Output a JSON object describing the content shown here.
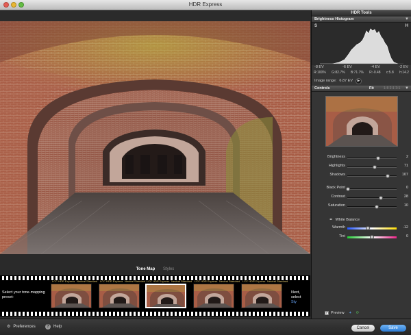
{
  "window": {
    "title": "HDR Express"
  },
  "panel": {
    "title": "HDR Tools",
    "histogram": {
      "header": "Brightness Histogram",
      "shadow_label": "S",
      "highlight_label": "H",
      "ev_labels": [
        "-8 EV",
        "-6 EV",
        "-4 EV",
        "-2 EV"
      ],
      "stats": [
        "R:100%",
        "G:82.7%",
        "B:71.7%",
        "R:-0.48",
        "c:5.8",
        "h:14.2"
      ],
      "range_label": "Image range:",
      "range_value": "6.87 EV"
    },
    "controls": {
      "header": "Controls",
      "fit_label": "Fit",
      "zoom_label": "1:8  2:1  3:1",
      "sliders": [
        {
          "label": "Brightness",
          "value": "2",
          "fraction": 0.62
        },
        {
          "label": "Highlights",
          "value": "71",
          "fraction": 0.55
        },
        {
          "label": "Shadows",
          "value": "107",
          "fraction": 0.82
        }
      ],
      "sliders2": [
        {
          "label": "Black Point",
          "value": "0",
          "fraction": 0.02
        },
        {
          "label": "Contrast",
          "value": "28",
          "fraction": 0.68
        },
        {
          "label": "Saturation",
          "value": "10",
          "fraction": 0.6
        }
      ],
      "white_balance": "White Balance",
      "warmth": {
        "label": "Warmth",
        "value": "-12",
        "fraction": 0.42
      },
      "tint": {
        "label": "Tint",
        "value": "0",
        "fraction": 0.5
      }
    },
    "preview_label": "Preview"
  },
  "tabs": [
    {
      "label": "Tone Map",
      "active": true
    },
    {
      "label": "Styles",
      "active": false
    }
  ],
  "filmstrip": {
    "prompt_left": "Select your tone-mapping preset:",
    "prompt_right": "Next, select",
    "prompt_right_link": "Sty",
    "frames": [
      {
        "tag_left": "LCC HDR Express",
        "tag_right": "Neutral Standard"
      },
      {
        "tag_left": "LCC HDR Express",
        "tag_right": "Neutral Standard"
      },
      {
        "tag_left": "LCC HDR Express",
        "tag_right": "Neutral Standard"
      },
      {
        "tag_left": "LCC HDR Express",
        "tag_right": "Neutral Standard"
      },
      {
        "tag_left": "LCC HDR Express",
        "tag_right": "Neutral Standard"
      }
    ],
    "selected_index": 2
  },
  "bottombar": {
    "preferences": "Preferences",
    "help": "Help",
    "cancel": "Cancel",
    "save": "Save"
  },
  "colors": {
    "accent": "#2c7cd4",
    "brick": "#a55a44",
    "moss": "#9a9a3a"
  }
}
